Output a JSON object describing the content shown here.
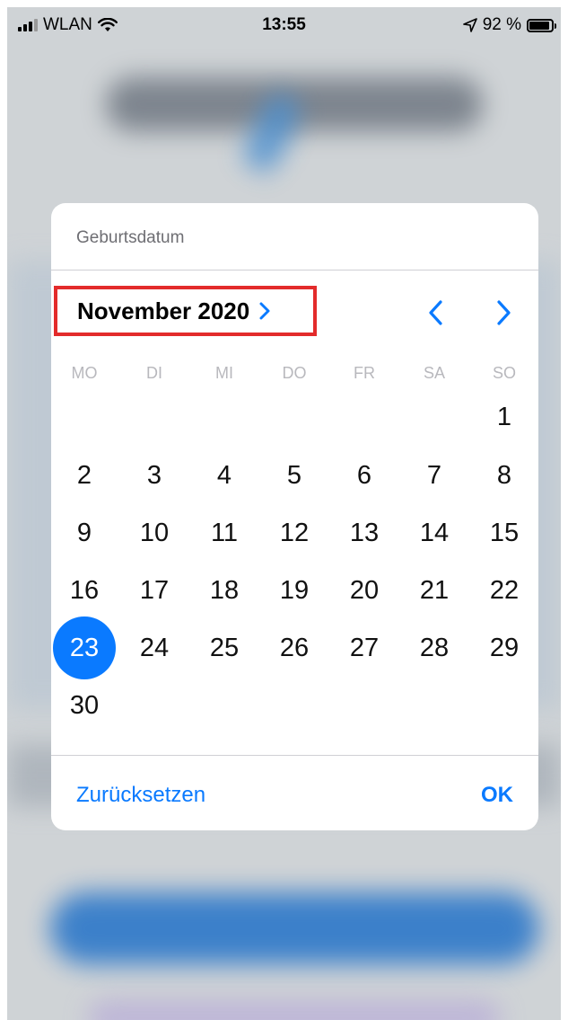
{
  "status_bar": {
    "carrier": "WLAN",
    "time": "13:55",
    "battery": "92 %"
  },
  "dialog": {
    "title": "Geburtsdatum",
    "month_year": "November 2020",
    "weekdays": [
      "MO",
      "DI",
      "MI",
      "DO",
      "FR",
      "SA",
      "SO"
    ],
    "days": [
      [
        "",
        "",
        "",
        "",
        "",
        "",
        "1"
      ],
      [
        "2",
        "3",
        "4",
        "5",
        "6",
        "7",
        "8"
      ],
      [
        "9",
        "10",
        "11",
        "12",
        "13",
        "14",
        "15"
      ],
      [
        "16",
        "17",
        "18",
        "19",
        "20",
        "21",
        "22"
      ],
      [
        "23",
        "24",
        "25",
        "26",
        "27",
        "28",
        "29"
      ],
      [
        "30",
        "",
        "",
        "",
        "",
        "",
        ""
      ]
    ],
    "selected_day": "23",
    "reset_label": "Zurücksetzen",
    "ok_label": "OK"
  },
  "colors": {
    "accent": "#0a7aff",
    "highlight_box": "#e32b2b"
  },
  "icons": {
    "month_expand": "chevron-right-icon",
    "prev": "chevron-left-icon",
    "next": "chevron-right-icon",
    "wifi": "wifi-icon",
    "location": "location-arrow-icon",
    "battery": "battery-icon",
    "signal": "cellular-signal-icon"
  }
}
